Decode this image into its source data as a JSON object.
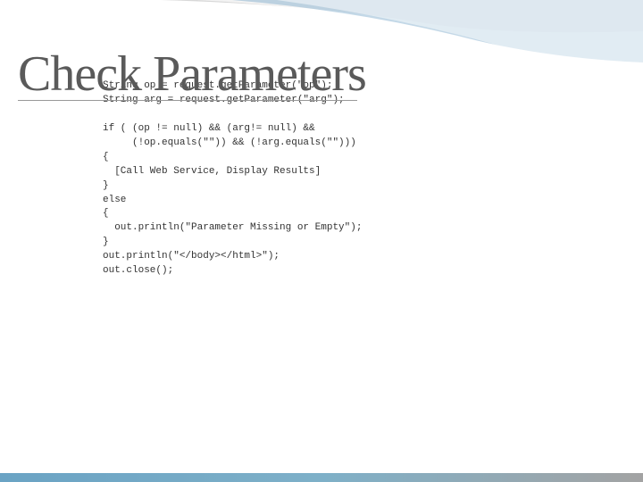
{
  "title": "Check Parameters",
  "code": {
    "line1": "String op = request.getParameter(\"op\");",
    "line2": "String arg = request.getParameter(\"arg\");",
    "line3": "",
    "line4": "if ( (op != null) && (arg!= null) &&",
    "line5": "     (!op.equals(\"\")) && (!arg.equals(\"\")))",
    "line6": "{",
    "line7": "  [Call Web Service, Display Results]",
    "line8": "}",
    "line9": "else",
    "line10": "{",
    "line11": "  out.println(\"Parameter Missing or Empty\");",
    "line12": "}",
    "line13": "out.println(\"</body></html>\");",
    "line14": "out.close();"
  },
  "colors": {
    "wave_blue": "#7aa8c9",
    "wave_gray": "#b8b8b8",
    "title_color": "#5a5a5a"
  }
}
